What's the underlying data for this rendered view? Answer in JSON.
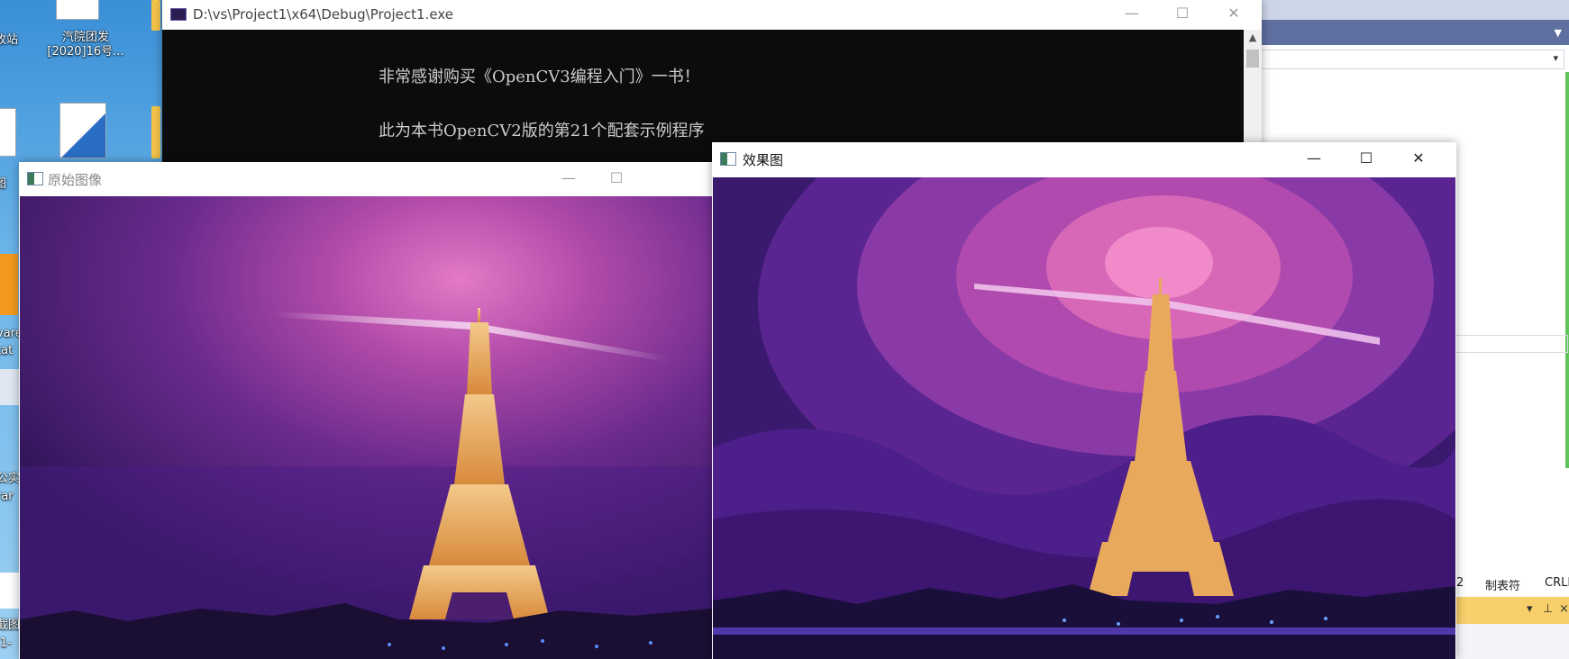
{
  "desktop": {
    "icon_top_label_line1": "汽院团发",
    "icon_top_label_line2": "[2020]16号...",
    "left_edge_labels": [
      "收站",
      "图",
      "vare",
      "tat",
      "公实",
      "rar",
      "截图",
      "1-"
    ]
  },
  "console_window": {
    "title": "D:\\vs\\Project1\\x64\\Debug\\Project1.exe",
    "icon": "console-app-icon",
    "lines": [
      "非常感谢购买《OpenCV3编程入门》一书！",
      "此为本书OpenCV2版的第21个配套示例程序"
    ],
    "minimize_glyph": "—",
    "maximize_glyph": "☐",
    "close_glyph": "✕"
  },
  "original_window": {
    "title": "原始图像",
    "icon": "opencv-window-icon",
    "minimize_glyph": "—",
    "maximize_glyph": "☐"
  },
  "effect_window": {
    "title": "效果图",
    "icon": "opencv-window-icon",
    "minimize_glyph": "—",
    "maximize_glyph": "☐",
    "close_glyph": "✕"
  },
  "vs_background": {
    "status_col": "2",
    "status_tabs": "制表符",
    "status_eol": "CRLF",
    "panel_controls": [
      "▾",
      "⊥",
      "×"
    ],
    "accent": "#5f6fa0"
  },
  "colors": {
    "console_bg": "#0c0c0c",
    "console_text": "#cccccc",
    "sky_top": "#3b1460",
    "sky_glow": "#d04fa8",
    "tower_gold": "#e8b066"
  }
}
